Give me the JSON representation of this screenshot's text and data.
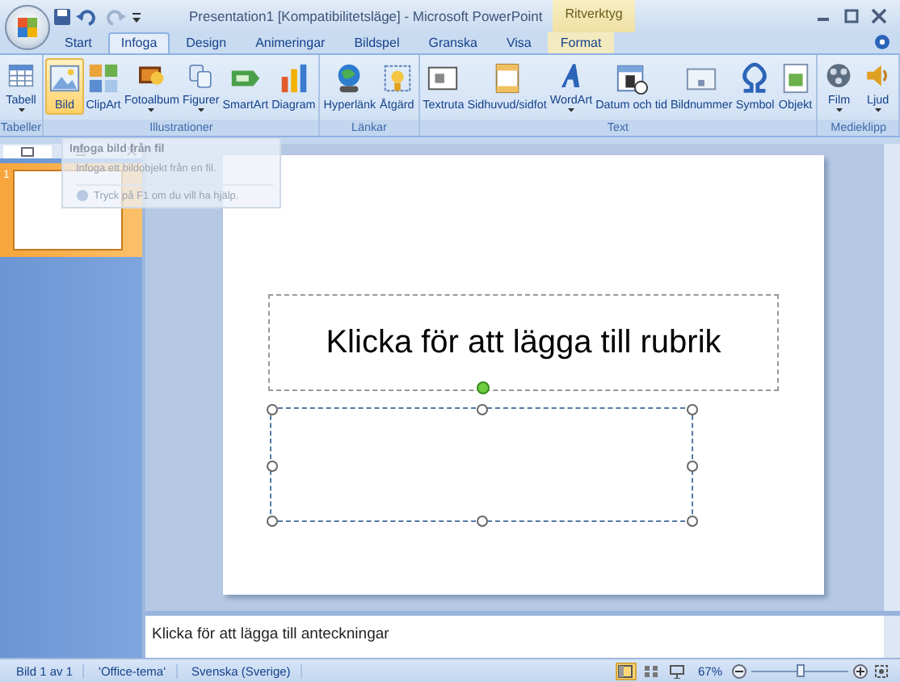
{
  "window": {
    "title": "Presentation1 [Kompatibilitetsläge] - Microsoft PowerPoint",
    "contextual_label": "Ritverktyg"
  },
  "tabs": [
    {
      "label": "Start",
      "selected": false,
      "contextual": false
    },
    {
      "label": "Infoga",
      "selected": true,
      "contextual": false
    },
    {
      "label": "Design",
      "selected": false,
      "contextual": false
    },
    {
      "label": "Animeringar",
      "selected": false,
      "contextual": false
    },
    {
      "label": "Bildspel",
      "selected": false,
      "contextual": false
    },
    {
      "label": "Granska",
      "selected": false,
      "contextual": false
    },
    {
      "label": "Visa",
      "selected": false,
      "contextual": false
    },
    {
      "label": "Format",
      "selected": false,
      "contextual": true
    }
  ],
  "ribbon_groups": [
    {
      "label": "Tabeller",
      "buttons": [
        {
          "label": "Tabell",
          "dropdown": true,
          "selected": false
        }
      ]
    },
    {
      "label": "Illustrationer",
      "buttons": [
        {
          "label": "Bild",
          "dropdown": false,
          "selected": true
        },
        {
          "label": "ClipArt",
          "dropdown": false,
          "selected": false
        },
        {
          "label": "Fotoalbum",
          "dropdown": true,
          "selected": false
        },
        {
          "label": "Figurer",
          "dropdown": true,
          "selected": false
        },
        {
          "label": "SmartArt",
          "dropdown": false,
          "selected": false
        },
        {
          "label": "Diagram",
          "dropdown": false,
          "selected": false
        }
      ]
    },
    {
      "label": "Länkar",
      "buttons": [
        {
          "label": "Hyperlänk",
          "dropdown": false,
          "selected": false
        },
        {
          "label": "Åtgärd",
          "dropdown": false,
          "selected": false
        }
      ]
    },
    {
      "label": "Text",
      "buttons": [
        {
          "label": "Textruta",
          "dropdown": false,
          "selected": false
        },
        {
          "label": "Sidhuvud/sidfot",
          "dropdown": false,
          "selected": false
        },
        {
          "label": "WordArt",
          "dropdown": true,
          "selected": false
        },
        {
          "label": "Datum och tid",
          "dropdown": false,
          "selected": false
        },
        {
          "label": "Bildnummer",
          "dropdown": false,
          "selected": false
        },
        {
          "label": "Symbol",
          "dropdown": false,
          "selected": false
        },
        {
          "label": "Objekt",
          "dropdown": false,
          "selected": false
        }
      ]
    },
    {
      "label": "Medieklipp",
      "buttons": [
        {
          "label": "Film",
          "dropdown": true,
          "selected": false
        },
        {
          "label": "Ljud",
          "dropdown": true,
          "selected": false
        }
      ]
    }
  ],
  "tooltip": {
    "title": "Infoga bild från fil",
    "description": "Infoga ett bildobjekt från en fil.",
    "help": "Tryck på F1 om du vill ha hjälp."
  },
  "slides": [
    {
      "number": "1",
      "selected": true
    }
  ],
  "slide": {
    "title_placeholder": "Klicka för att lägga till rubrik"
  },
  "notes": {
    "placeholder": "Klicka för att lägga till anteckningar"
  },
  "status_bar": {
    "items": [
      "Bild 1 av 1",
      "'Office-tema'",
      "Svenska (Sverige)"
    ],
    "views": [
      {
        "selected": true
      },
      {
        "selected": false
      },
      {
        "selected": false
      }
    ],
    "zoom": "67%",
    "zoom_level": {
      "level": 0.5
    }
  }
}
